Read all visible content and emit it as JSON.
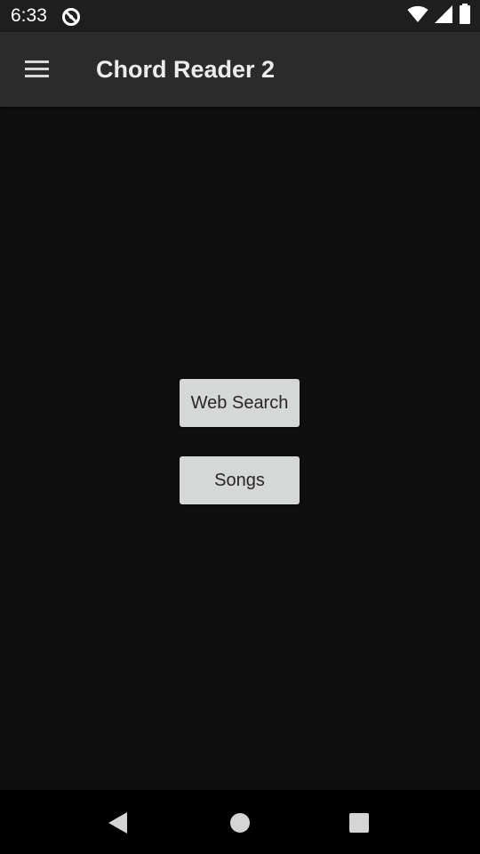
{
  "status_bar": {
    "time": "6:33",
    "icons": [
      "notification-icon",
      "wifi-icon",
      "signal-icon",
      "battery-icon"
    ]
  },
  "app_bar": {
    "menu_icon": "menu-icon",
    "title": "Chord Reader 2"
  },
  "main": {
    "buttons": [
      {
        "label": "Web Search"
      },
      {
        "label": "Songs"
      }
    ]
  },
  "nav_bar": {
    "icons": [
      "back-icon",
      "home-icon",
      "recents-icon"
    ]
  },
  "colors": {
    "status_bar_bg": "#1e1e1e",
    "app_bar_bg": "#2b2b2b",
    "content_bg": "#0f0f0f",
    "button_bg": "#d6d7d7",
    "button_text": "#262626",
    "nav_bar_bg": "#000000"
  }
}
